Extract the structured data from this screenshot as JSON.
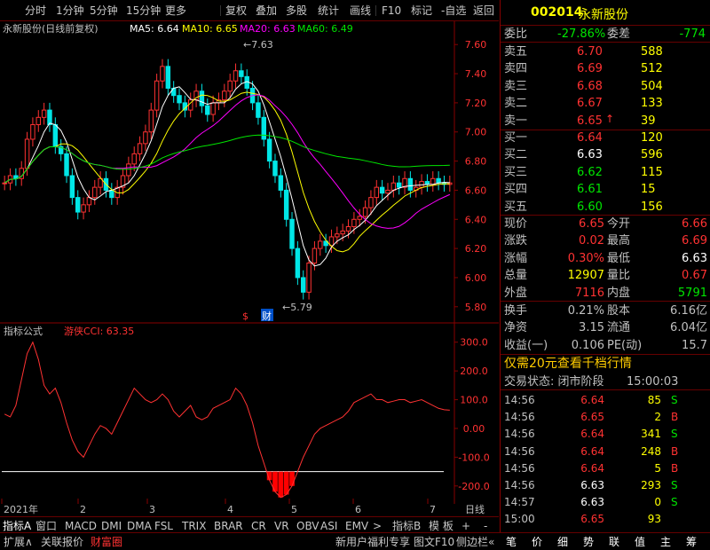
{
  "toolbar": {
    "logo": "",
    "items": [
      "分时",
      "1分钟",
      "5分钟",
      "15分钟",
      "更多",
      "复权",
      "叠加",
      "多股",
      "统计",
      "画线",
      "F10",
      "标记",
      "-自选",
      "返回"
    ]
  },
  "stock": {
    "code": "002014",
    "name": "永新股份"
  },
  "ma_legend": {
    "title": "永新股份(日线前复权)",
    "ma5": "MA5: 6.64",
    "ma10": "MA10: 6.65",
    "ma20": "MA20: 6.63",
    "ma60": "MA60: 6.49"
  },
  "price_axis": [
    "7.60",
    "7.40",
    "7.20",
    "7.00",
    "6.80",
    "6.60",
    "6.40",
    "6.20",
    "6.00",
    "5.80"
  ],
  "annotations": {
    "high": "7.63",
    "low": "5.79",
    "s_mark": "$",
    "cai_mark": "财"
  },
  "indicator": {
    "label": "指标公式",
    "name": "游侠CCI: 63.35",
    "axis": [
      "300.0",
      "200.0",
      "100.0",
      "0.00",
      "-100.0",
      "-200.0"
    ]
  },
  "xaxis": {
    "labels": [
      "2021年",
      "2",
      "3",
      "4",
      "5",
      "6",
      "7"
    ],
    "right": "日线"
  },
  "bottom_tabs": [
    "指标A",
    "窗口",
    "MACD",
    "DMI",
    "DMA",
    "FSL",
    "TRIX",
    "BRAR",
    "CR",
    "VR",
    "OBV",
    "ASI",
    "EMV",
    ">",
    "指标B",
    "模 板",
    "+",
    "-"
  ],
  "status_tabs": [
    "扩展∧",
    "关联报价",
    "财富圈"
  ],
  "status_right": [
    "新用户福利专享",
    "图文F10",
    "侧边栏«"
  ],
  "right_tabs": [
    "笔",
    "价",
    "细",
    "势",
    "联",
    "值",
    "主",
    "筹"
  ],
  "weibi": {
    "l1": "委比",
    "v1": "-27.86%",
    "l2": "委差",
    "v2": "-774"
  },
  "sells": [
    {
      "l": "卖五",
      "p": "6.70",
      "v": "588"
    },
    {
      "l": "卖四",
      "p": "6.69",
      "v": "512"
    },
    {
      "l": "卖三",
      "p": "6.68",
      "v": "504"
    },
    {
      "l": "卖二",
      "p": "6.67",
      "v": "133"
    },
    {
      "l": "卖一",
      "p": "6.65",
      "v": "39"
    }
  ],
  "buys": [
    {
      "l": "买一",
      "p": "6.64",
      "v": "120"
    },
    {
      "l": "买二",
      "p": "6.63",
      "v": "596"
    },
    {
      "l": "买三",
      "p": "6.62",
      "v": "115"
    },
    {
      "l": "买四",
      "p": "6.61",
      "v": "15"
    },
    {
      "l": "买五",
      "p": "6.60",
      "v": "156"
    }
  ],
  "quote": [
    {
      "l1": "现价",
      "v1": "6.65",
      "l2": "今开",
      "v2": "6.66"
    },
    {
      "l1": "涨跌",
      "v1": "0.02",
      "l2": "最高",
      "v2": "6.69"
    },
    {
      "l1": "涨幅",
      "v1": "0.30%",
      "l2": "最低",
      "v2": "6.63"
    },
    {
      "l1": "总量",
      "v1": "12907",
      "l2": "量比",
      "v2": "0.67"
    },
    {
      "l1": "外盘",
      "v1": "7116",
      "l2": "内盘",
      "v2": "5791"
    }
  ],
  "stats": [
    {
      "l1": "换手",
      "v1": "0.21%",
      "l2": "股本",
      "v2": "6.16亿"
    },
    {
      "l1": "净资",
      "v1": "3.15",
      "l2": "流通",
      "v2": "6.04亿"
    },
    {
      "l1": "收益(一)",
      "v1": "0.106",
      "l2": "PE(动)",
      "v2": "15.7"
    }
  ],
  "promo": "仅需20元查看千档行情",
  "trade_status": {
    "label": "交易状态: 闭市阶段",
    "time": "15:00:03"
  },
  "ticks": [
    {
      "t": "14:56",
      "p": "6.64",
      "v": "85",
      "bs": "S"
    },
    {
      "t": "14:56",
      "p": "6.65",
      "v": "2",
      "bs": "B"
    },
    {
      "t": "14:56",
      "p": "6.64",
      "v": "341",
      "bs": "S"
    },
    {
      "t": "14:56",
      "p": "6.64",
      "v": "248",
      "bs": "B"
    },
    {
      "t": "14:56",
      "p": "6.64",
      "v": "5",
      "bs": "B"
    },
    {
      "t": "14:56",
      "p": "6.63",
      "v": "293",
      "bs": "S"
    },
    {
      "t": "14:57",
      "p": "6.63",
      "v": "0",
      "bs": "S"
    },
    {
      "t": "15:00",
      "p": "6.65",
      "v": "93",
      "bs": ""
    }
  ],
  "chart_data": {
    "type": "candlestick",
    "ohlc_close": [
      6.65,
      6.7,
      6.68,
      6.75,
      6.95,
      7.05,
      7.1,
      7.15,
      7.05,
      6.9,
      6.85,
      6.7,
      6.55,
      6.45,
      6.5,
      6.55,
      6.62,
      6.68,
      6.6,
      6.55,
      6.62,
      6.7,
      6.78,
      6.85,
      6.92,
      7.0,
      7.15,
      7.35,
      7.45,
      7.3,
      7.25,
      7.2,
      7.15,
      7.22,
      7.28,
      7.18,
      7.12,
      7.2,
      7.22,
      7.28,
      7.35,
      7.42,
      7.38,
      7.3,
      7.2,
      7.1,
      6.95,
      6.8,
      6.7,
      6.6,
      6.4,
      6.2,
      6.0,
      5.9,
      6.1,
      6.2,
      6.25,
      6.22,
      6.28,
      6.3,
      6.32,
      6.35,
      6.4,
      6.42,
      6.48,
      6.55,
      6.62,
      6.58,
      6.6,
      6.65,
      6.62,
      6.68,
      6.6,
      6.62,
      6.66,
      6.64,
      6.68,
      6.65,
      6.64,
      6.65
    ],
    "cci": [
      50,
      40,
      80,
      170,
      260,
      300,
      240,
      150,
      120,
      140,
      90,
      20,
      -40,
      -80,
      -100,
      -60,
      -20,
      10,
      0,
      -20,
      20,
      60,
      100,
      140,
      120,
      100,
      90,
      100,
      120,
      100,
      60,
      40,
      60,
      80,
      40,
      30,
      40,
      70,
      80,
      90,
      100,
      140,
      120,
      80,
      20,
      -60,
      -120,
      -180,
      -220,
      -240,
      -230,
      -200,
      -150,
      -100,
      -60,
      -20,
      0,
      10,
      20,
      30,
      40,
      60,
      90,
      100,
      110,
      120,
      100,
      100,
      90,
      95,
      100,
      100,
      90,
      95,
      100,
      90,
      80,
      70,
      65,
      63.35
    ],
    "ylim_price": [
      5.75,
      7.65
    ],
    "ylim_cci": [
      -250,
      330
    ]
  }
}
